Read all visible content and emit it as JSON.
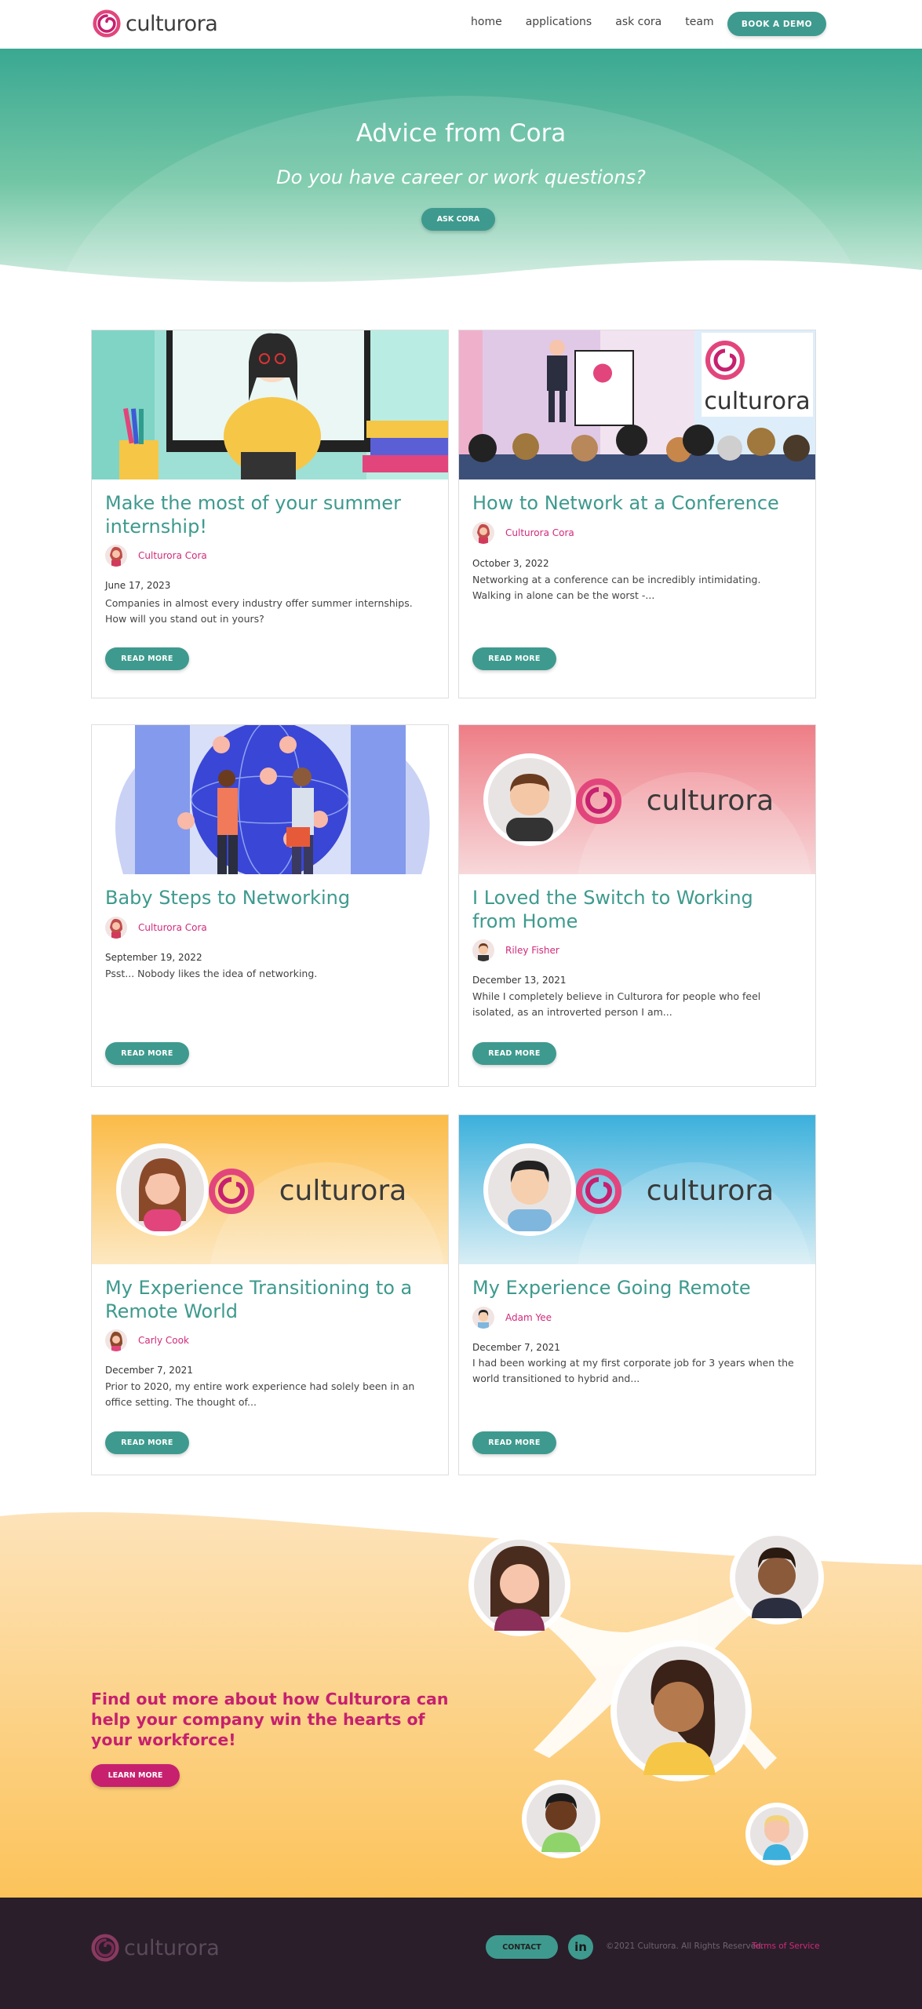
{
  "brand": {
    "name": "culturora"
  },
  "nav": {
    "links": [
      "home",
      "applications",
      "ask cora",
      "team"
    ],
    "demo_button": "BOOK A DEMO"
  },
  "hero": {
    "title": "Advice from Cora",
    "subtitle": "Do you have career or work questions?",
    "button": "ASK CORA"
  },
  "cards": [
    {
      "title": "Make the most of your summer internship!",
      "author": "Culturora Cora",
      "date": "June 17, 2023",
      "excerpt": "Companies in almost every industry offer summer internships. How will you stand out in yours?",
      "button": "READ MORE"
    },
    {
      "title": "How to Network at a Conference",
      "author": "Culturora Cora",
      "date": "October 3, 2022",
      "excerpt": "Networking at a conference can be incredibly intimidating. Walking in alone can be the worst -...",
      "button": "READ MORE",
      "image_logo": "culturora"
    },
    {
      "title": "Baby Steps to Networking",
      "author": "Culturora Cora",
      "date": "September 19, 2022",
      "excerpt": "Psst... Nobody likes the idea of networking.",
      "button": "READ MORE"
    },
    {
      "title": "I Loved the Switch to Working from Home",
      "author": "Riley Fisher",
      "date": "December 13, 2021",
      "excerpt": "While I completely believe in Culturora for people who feel isolated, as an introverted person I am...",
      "button": "READ MORE",
      "image_logo": "culturora"
    },
    {
      "title": "My Experience Transitioning to a Remote World",
      "author": "Carly Cook",
      "date": "December 7, 2021",
      "excerpt": "Prior to 2020, my entire work experience had solely been in an office setting. The thought of...",
      "button": "READ MORE",
      "image_logo": "culturora"
    },
    {
      "title": "My Experience Going Remote",
      "author": "Adam Yee",
      "date": "December 7, 2021",
      "excerpt": "I had been working at my first corporate job for 3 years when the world transitioned to hybrid and...",
      "button": "READ MORE",
      "image_logo": "culturora"
    }
  ],
  "cta": {
    "text": "Find out more about how Culturora can help your company win the hearts of your workforce!",
    "button": "LEARN MORE"
  },
  "footer": {
    "contact": "CONTACT",
    "linkedin": "in",
    "copyright": "©2021 Culturora. All Rights Reserved.",
    "terms": "Terms of Service"
  },
  "colors": {
    "teal": "#3e9a8e",
    "magenta": "#c6206f",
    "footer_bg": "#2a1e2a"
  }
}
